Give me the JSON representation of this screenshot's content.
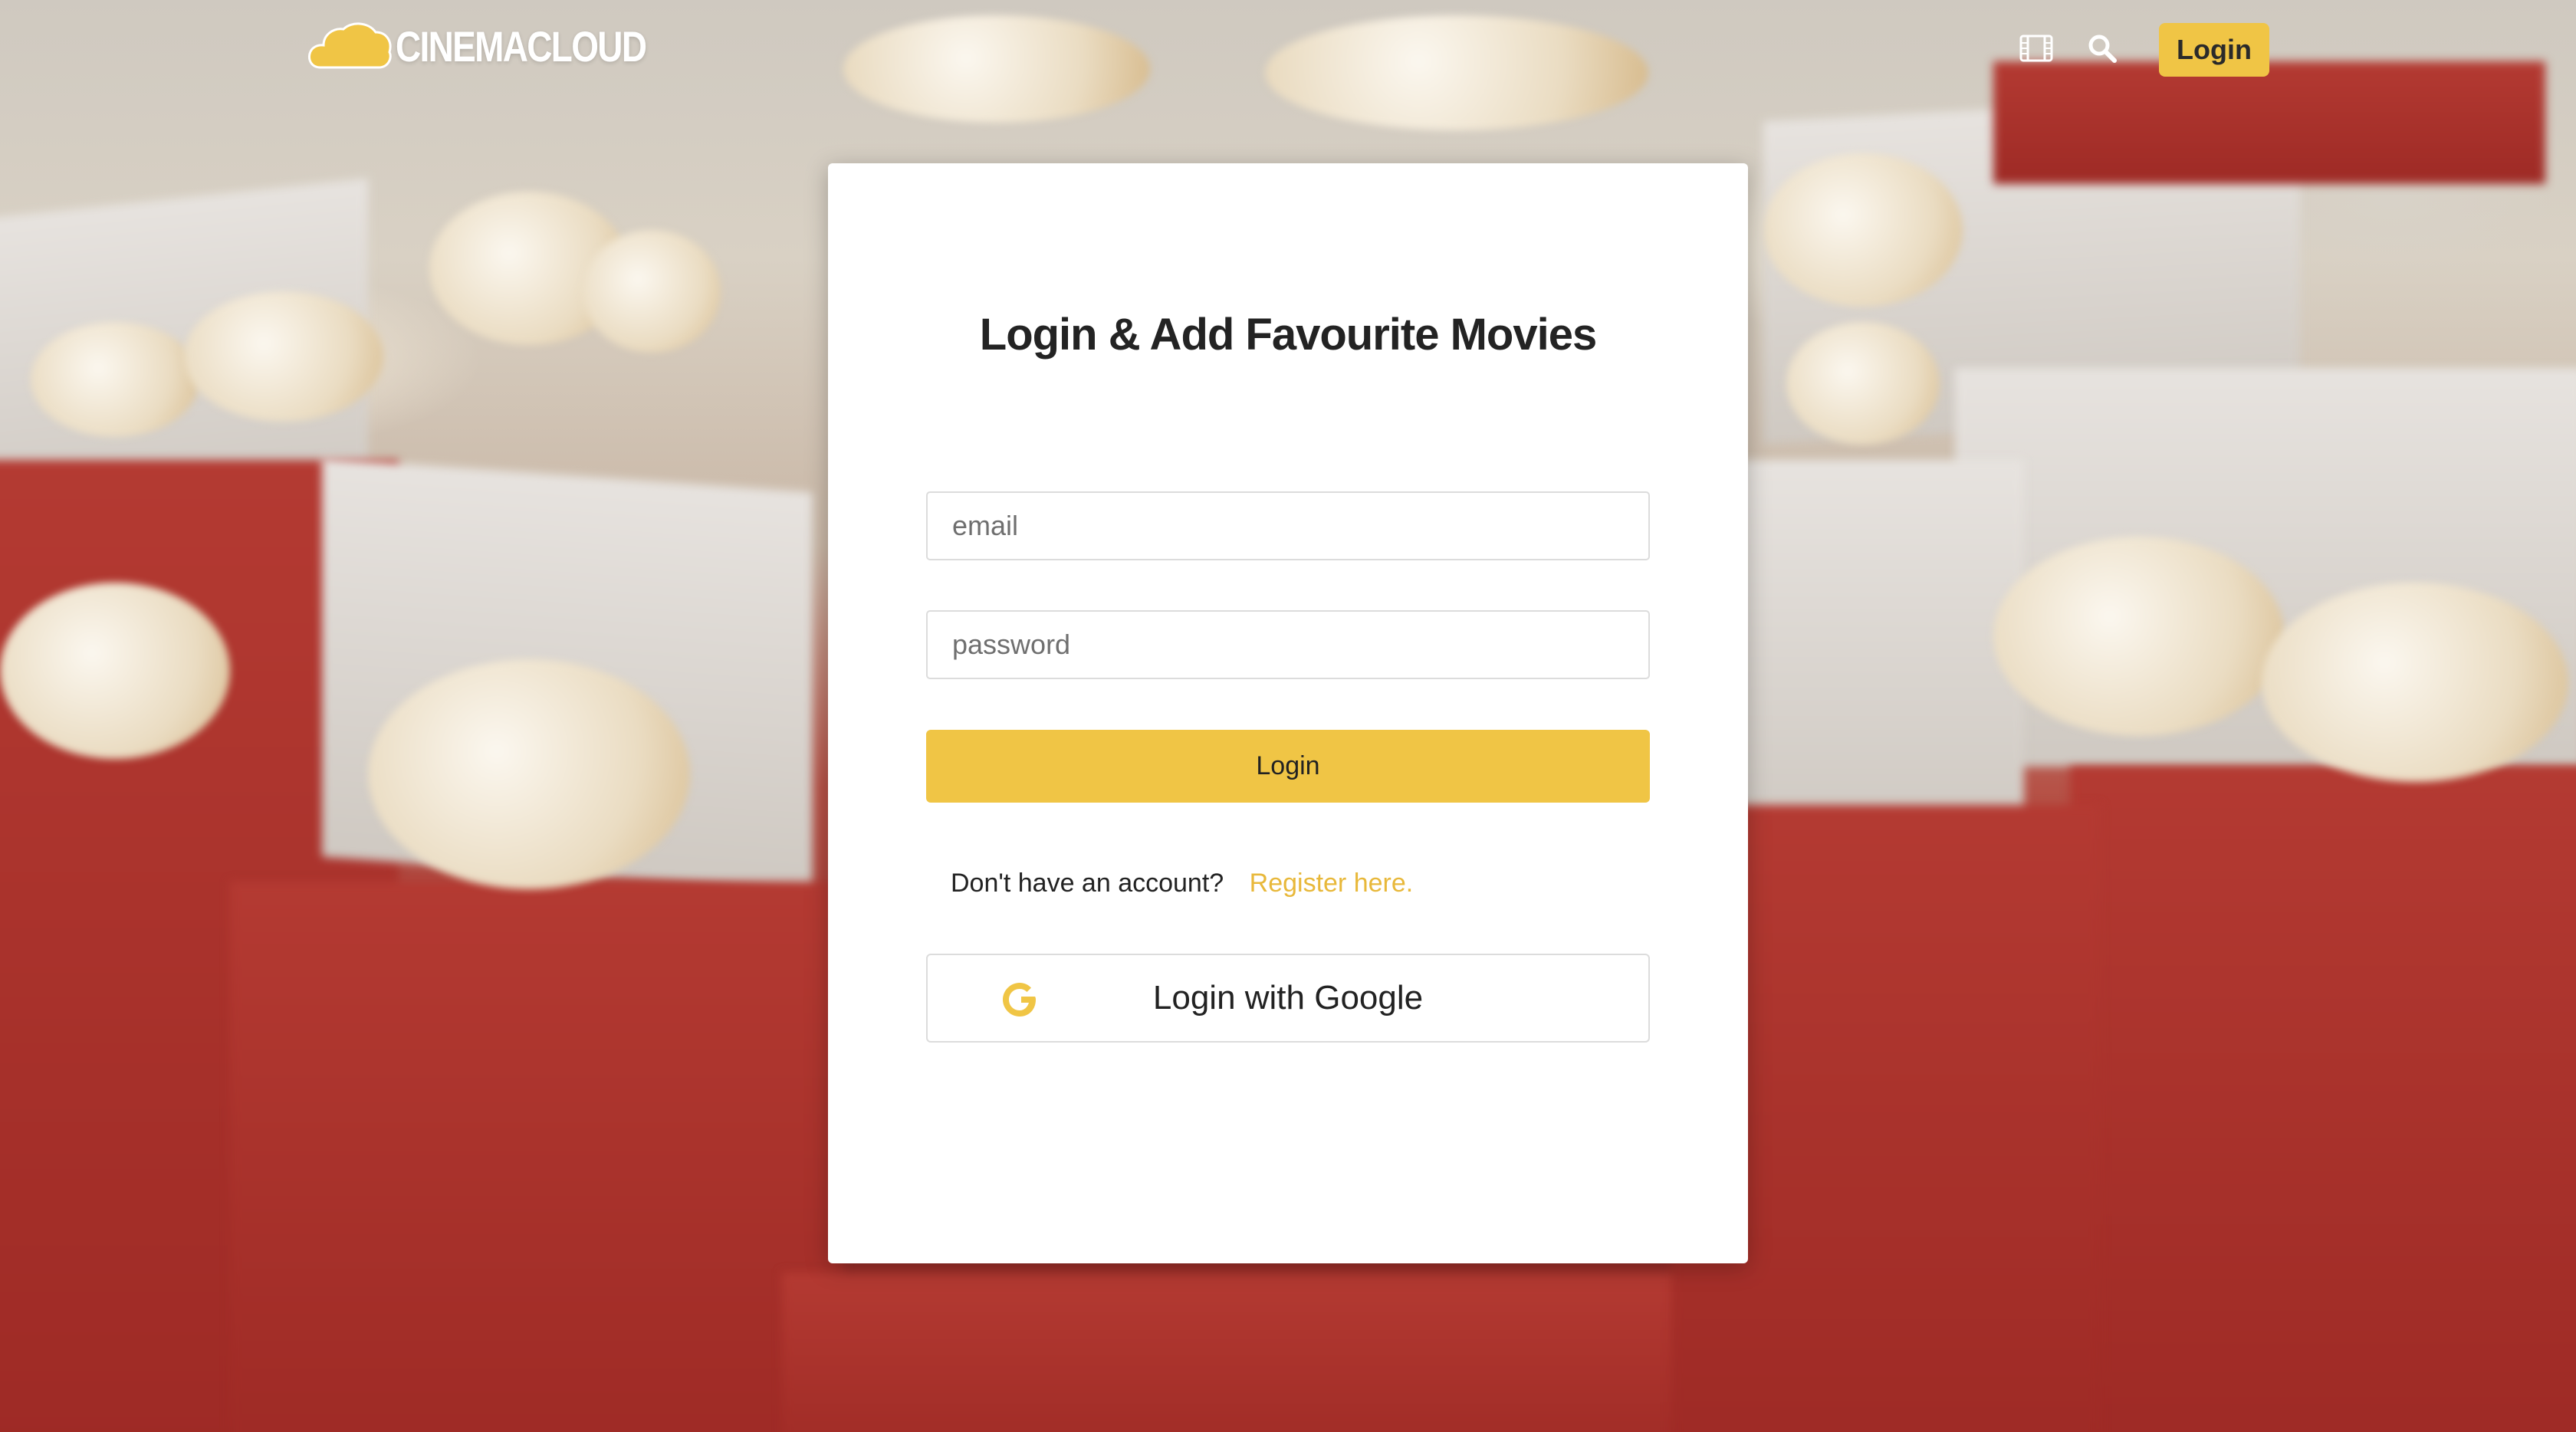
{
  "header": {
    "brand": "CINEMACLOUD",
    "login_label": "Login",
    "icons": [
      "film-icon",
      "search-icon",
      "cloud-logo-icon"
    ]
  },
  "login_card": {
    "title": "Login & Add Favourite Movies",
    "email_placeholder": "email",
    "password_placeholder": "password",
    "login_button_label": "Login",
    "register_prompt": "Don't have an account?",
    "register_link": "Register here.",
    "google_button_label": "Login with Google"
  },
  "colors": {
    "accent": "#f0c545",
    "link": "#e8b83a",
    "card_bg": "#ffffff",
    "text": "#232323"
  }
}
